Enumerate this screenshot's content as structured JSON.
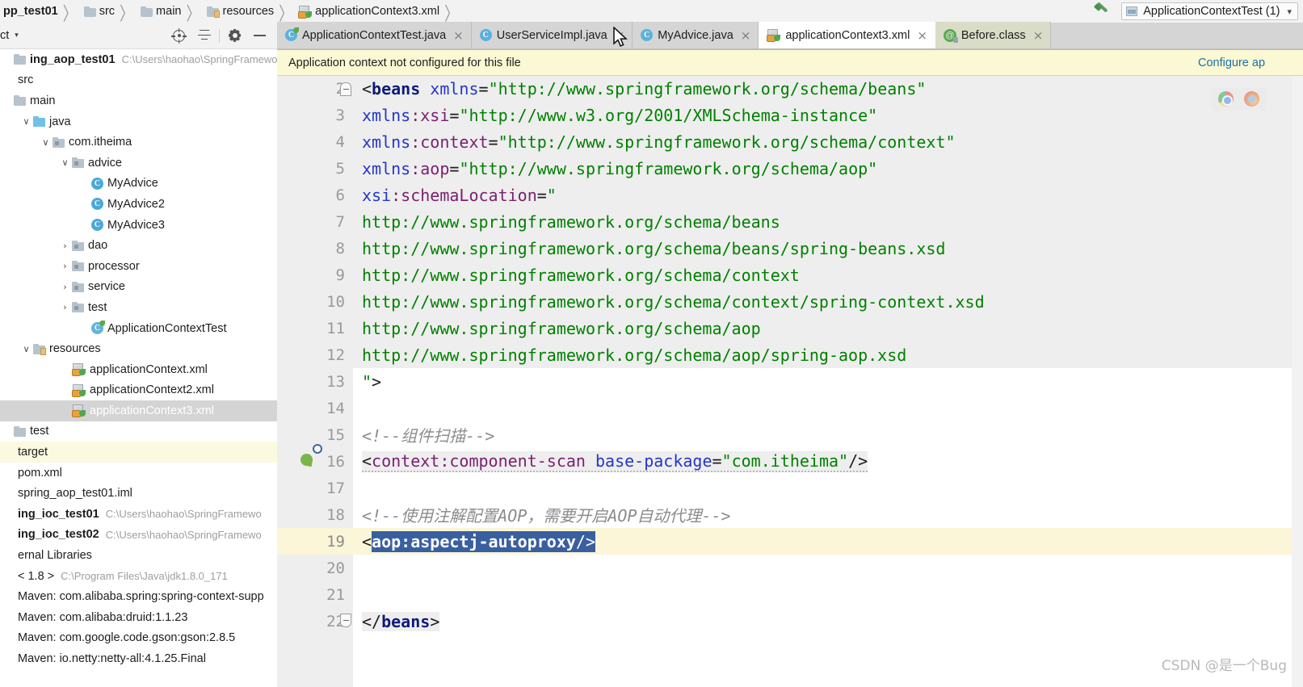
{
  "breadcrumb": {
    "items": [
      {
        "label": "pp_test01",
        "icon": "module-icon",
        "bold": true
      },
      {
        "label": "src",
        "icon": "folder-icon",
        "bold": false
      },
      {
        "label": "main",
        "icon": "folder-icon",
        "bold": false
      },
      {
        "label": "resources",
        "icon": "resources-folder-icon",
        "bold": false
      },
      {
        "label": "applicationContext3.xml",
        "icon": "spring-xml-icon",
        "bold": false
      }
    ],
    "separator": "〉"
  },
  "toprightbar": {
    "build_icon": "hammer-icon",
    "run_config": "ApplicationContextTest (1)",
    "run_config_caret": "▾"
  },
  "project_panel": {
    "title": "ct",
    "caret": "▾",
    "tools": [
      {
        "name": "locate-in-tree-icon",
        "label": "target-icon"
      },
      {
        "name": "collapse-all-icon",
        "label": "collapse-icon"
      },
      {
        "name": "settings-gear-icon",
        "label": "gear-icon"
      },
      {
        "name": "hide-panel-icon",
        "label": "minimize-icon"
      }
    ]
  },
  "tree": {
    "items": [
      {
        "indent": 0,
        "arrow": "",
        "icon": "module-icon",
        "label": "ing_aop_test01",
        "bold": true,
        "path": "C:\\Users\\haohao\\SpringFramewo",
        "state": "normal"
      },
      {
        "indent": 0,
        "arrow": "",
        "icon": "none",
        "label": "src",
        "bold": false,
        "path": "",
        "state": "normal"
      },
      {
        "indent": 0,
        "arrow": "",
        "icon": "folder-icon",
        "label": "main",
        "bold": false,
        "path": "",
        "state": "normal"
      },
      {
        "indent": 1,
        "arrow": "∨",
        "icon": "source-folder-icon",
        "label": "java",
        "bold": false,
        "path": "",
        "state": "normal"
      },
      {
        "indent": 2,
        "arrow": "∨",
        "icon": "package-icon",
        "label": "com.itheima",
        "bold": false,
        "path": "",
        "state": "normal"
      },
      {
        "indent": 3,
        "arrow": "∨",
        "icon": "package-icon",
        "label": "advice",
        "bold": false,
        "path": "",
        "state": "normal"
      },
      {
        "indent": 4,
        "arrow": "",
        "icon": "java-class-icon",
        "label": "MyAdvice",
        "bold": false,
        "path": "",
        "state": "normal"
      },
      {
        "indent": 4,
        "arrow": "",
        "icon": "java-class-icon",
        "label": "MyAdvice2",
        "bold": false,
        "path": "",
        "state": "normal"
      },
      {
        "indent": 4,
        "arrow": "",
        "icon": "java-class-icon",
        "label": "MyAdvice3",
        "bold": false,
        "path": "",
        "state": "normal"
      },
      {
        "indent": 3,
        "arrow": "›",
        "icon": "package-icon",
        "label": "dao",
        "bold": false,
        "path": "",
        "state": "normal"
      },
      {
        "indent": 3,
        "arrow": "›",
        "icon": "package-icon",
        "label": "processor",
        "bold": false,
        "path": "",
        "state": "normal"
      },
      {
        "indent": 3,
        "arrow": "›",
        "icon": "package-icon",
        "label": "service",
        "bold": false,
        "path": "",
        "state": "normal"
      },
      {
        "indent": 3,
        "arrow": "›",
        "icon": "package-icon",
        "label": "test",
        "bold": false,
        "path": "",
        "state": "normal"
      },
      {
        "indent": 4,
        "arrow": "",
        "icon": "spring-class-icon",
        "label": "ApplicationContextTest",
        "bold": false,
        "path": "",
        "state": "normal"
      },
      {
        "indent": 1,
        "arrow": "∨",
        "icon": "resources-folder-icon",
        "label": "resources",
        "bold": false,
        "path": "",
        "state": "normal"
      },
      {
        "indent": 3,
        "arrow": "",
        "icon": "spring-xml-icon",
        "label": "applicationContext.xml",
        "bold": false,
        "path": "",
        "state": "normal"
      },
      {
        "indent": 3,
        "arrow": "",
        "icon": "spring-xml-icon",
        "label": "applicationContext2.xml",
        "bold": false,
        "path": "",
        "state": "normal"
      },
      {
        "indent": 3,
        "arrow": "",
        "icon": "spring-xml-icon",
        "label": "applicationContext3.xml",
        "bold": false,
        "path": "",
        "state": "selected"
      },
      {
        "indent": 0,
        "arrow": "",
        "icon": "folder-icon",
        "label": "test",
        "bold": false,
        "path": "",
        "state": "normal"
      },
      {
        "indent": 0,
        "arrow": "",
        "icon": "none",
        "label": "target",
        "bold": false,
        "path": "",
        "state": "highlight"
      },
      {
        "indent": 0,
        "arrow": "",
        "icon": "none",
        "label": "pom.xml",
        "bold": false,
        "path": "",
        "state": "normal"
      },
      {
        "indent": 0,
        "arrow": "",
        "icon": "none",
        "label": "spring_aop_test01.iml",
        "bold": false,
        "path": "",
        "state": "normal"
      },
      {
        "indent": 0,
        "arrow": "",
        "icon": "none",
        "label": "ing_ioc_test01",
        "bold": true,
        "path": "C:\\Users\\haohao\\SpringFramewo",
        "state": "normal"
      },
      {
        "indent": 0,
        "arrow": "",
        "icon": "none",
        "label": "ing_ioc_test02",
        "bold": true,
        "path": "C:\\Users\\haohao\\SpringFramewo",
        "state": "normal"
      },
      {
        "indent": 0,
        "arrow": "",
        "icon": "none",
        "label": "ernal Libraries",
        "bold": false,
        "path": "",
        "state": "normal"
      },
      {
        "indent": 0,
        "arrow": "",
        "icon": "none",
        "label": "< 1.8 >",
        "bold": false,
        "path": "C:\\Program Files\\Java\\jdk1.8.0_171",
        "state": "normal"
      },
      {
        "indent": 0,
        "arrow": "",
        "icon": "none",
        "label": "Maven: com.alibaba.spring:spring-context-supp",
        "bold": false,
        "path": "",
        "state": "normal"
      },
      {
        "indent": 0,
        "arrow": "",
        "icon": "none",
        "label": "Maven: com.alibaba:druid:1.1.23",
        "bold": false,
        "path": "",
        "state": "normal"
      },
      {
        "indent": 0,
        "arrow": "",
        "icon": "none",
        "label": "Maven: com.google.code.gson:gson:2.8.5",
        "bold": false,
        "path": "",
        "state": "normal"
      },
      {
        "indent": 0,
        "arrow": "",
        "icon": "none",
        "label": "Maven: io.netty:netty-all:4.1.25.Final",
        "bold": false,
        "path": "",
        "state": "normal"
      }
    ]
  },
  "tabs": [
    {
      "label": "ApplicationContextTest.java",
      "icon": "spring-java-class-icon",
      "active": false,
      "style": "plain",
      "close": "×"
    },
    {
      "label": "UserServiceImpl.java",
      "icon": "java-class-icon",
      "active": false,
      "style": "plain",
      "close": "×"
    },
    {
      "label": "MyAdvice.java",
      "icon": "java-class-icon",
      "active": false,
      "style": "plain",
      "close": "×"
    },
    {
      "label": "applicationContext3.xml",
      "icon": "spring-xml-icon",
      "active": true,
      "style": "active",
      "close": "×"
    },
    {
      "label": "Before.class",
      "icon": "annotation-class-icon",
      "active": false,
      "style": "greenish",
      "close": "×"
    }
  ],
  "notification": {
    "message": "Application context not configured for this file",
    "link": "Configure ap"
  },
  "editor": {
    "lines": [
      {
        "num": "2",
        "band": true,
        "fold": "top",
        "gutter_icon": "",
        "current": false
      },
      {
        "num": "3",
        "band": true,
        "fold": "",
        "gutter_icon": "",
        "current": false
      },
      {
        "num": "4",
        "band": true,
        "fold": "",
        "gutter_icon": "",
        "current": false
      },
      {
        "num": "5",
        "band": true,
        "fold": "",
        "gutter_icon": "",
        "current": false
      },
      {
        "num": "6",
        "band": true,
        "fold": "",
        "gutter_icon": "",
        "current": false
      },
      {
        "num": "7",
        "band": true,
        "fold": "",
        "gutter_icon": "",
        "current": false
      },
      {
        "num": "8",
        "band": true,
        "fold": "",
        "gutter_icon": "",
        "current": false
      },
      {
        "num": "9",
        "band": true,
        "fold": "",
        "gutter_icon": "",
        "current": false
      },
      {
        "num": "10",
        "band": true,
        "fold": "",
        "gutter_icon": "",
        "current": false
      },
      {
        "num": "11",
        "band": true,
        "fold": "",
        "gutter_icon": "",
        "current": false
      },
      {
        "num": "12",
        "band": true,
        "fold": "",
        "gutter_icon": "",
        "current": false
      },
      {
        "num": "13",
        "band": false,
        "fold": "",
        "gutter_icon": "",
        "current": false
      },
      {
        "num": "14",
        "band": false,
        "fold": "",
        "gutter_icon": "",
        "current": false
      },
      {
        "num": "15",
        "band": false,
        "fold": "",
        "gutter_icon": "",
        "current": false
      },
      {
        "num": "16",
        "band": false,
        "fold": "",
        "gutter_icon": "spring-bean-icon",
        "current": false
      },
      {
        "num": "17",
        "band": false,
        "fold": "",
        "gutter_icon": "",
        "current": false
      },
      {
        "num": "18",
        "band": false,
        "fold": "",
        "gutter_icon": "",
        "current": false
      },
      {
        "num": "19",
        "band": false,
        "fold": "",
        "gutter_icon": "",
        "current": true
      },
      {
        "num": "20",
        "band": false,
        "fold": "",
        "gutter_icon": "",
        "current": false
      },
      {
        "num": "21",
        "band": false,
        "fold": "",
        "gutter_icon": "",
        "current": false
      },
      {
        "num": "22",
        "band": false,
        "fold": "bottom",
        "gutter_icon": "",
        "current": false
      }
    ],
    "code_text": {
      "l2_a": "<",
      "l2_b": "beans",
      "l2_c": " xmlns",
      "l2_d": "=",
      "l2_e": "\"http://www.springframework.org/schema/beans\"",
      "l3_a": "xmlns",
      "l3_b": ":xsi",
      "l3_c": "=",
      "l3_d": "\"http://www.w3.org/2001/XMLSchema-instance\"",
      "l4_a": "xmlns",
      "l4_b": ":context",
      "l4_c": "=",
      "l4_d": "\"http://www.springframework.org/schema/context\"",
      "l5_a": "xmlns",
      "l5_b": ":aop",
      "l5_c": "=",
      "l5_d": "\"http://www.springframework.org/schema/aop\"",
      "l6_a": "xsi",
      "l6_b": ":schemaLocation",
      "l6_c": "=",
      "l6_d": "\"",
      "l7": "http://www.springframework.org/schema/beans",
      "l8": "http://www.springframework.org/schema/beans/spring-beans.xsd",
      "l9": "http://www.springframework.org/schema/context",
      "l10": "http://www.springframework.org/schema/context/spring-context.xsd",
      "l11": "http://www.springframework.org/schema/aop",
      "l12": "http://www.springframework.org/schema/aop/spring-aop.xsd",
      "l13_a": "\"",
      "l13_b": ">",
      "l15": "<!--组件扫描-->",
      "l16_a": "<",
      "l16_b": "context:component-scan",
      "l16_c": " base-package",
      "l16_d": "=",
      "l16_e": "\"com.itheima\"",
      "l16_f": "/>",
      "l18": "<!--使用注解配置AOP，需要开启AOP自动代理-->",
      "l19_a": "<",
      "l19_b": "aop:aspectj-autoproxy",
      "l19_c": "/>",
      "l22_a": "</",
      "l22_b": "beans",
      "l22_c": ">"
    },
    "browser_icons": [
      "chrome-icon",
      "firefox-icon"
    ]
  },
  "watermark": "CSDN @是一个Bug",
  "colors": {
    "tag": "#0e1a7a",
    "attribute": "#2436c8",
    "namespace": "#7a1f6e",
    "string": "#008000",
    "comment": "#8c8c8c",
    "selection": "#3a5fa0",
    "current_line": "#fbf6d8",
    "notification_bg": "#fbf8d4",
    "link": "#1d6fa5"
  }
}
